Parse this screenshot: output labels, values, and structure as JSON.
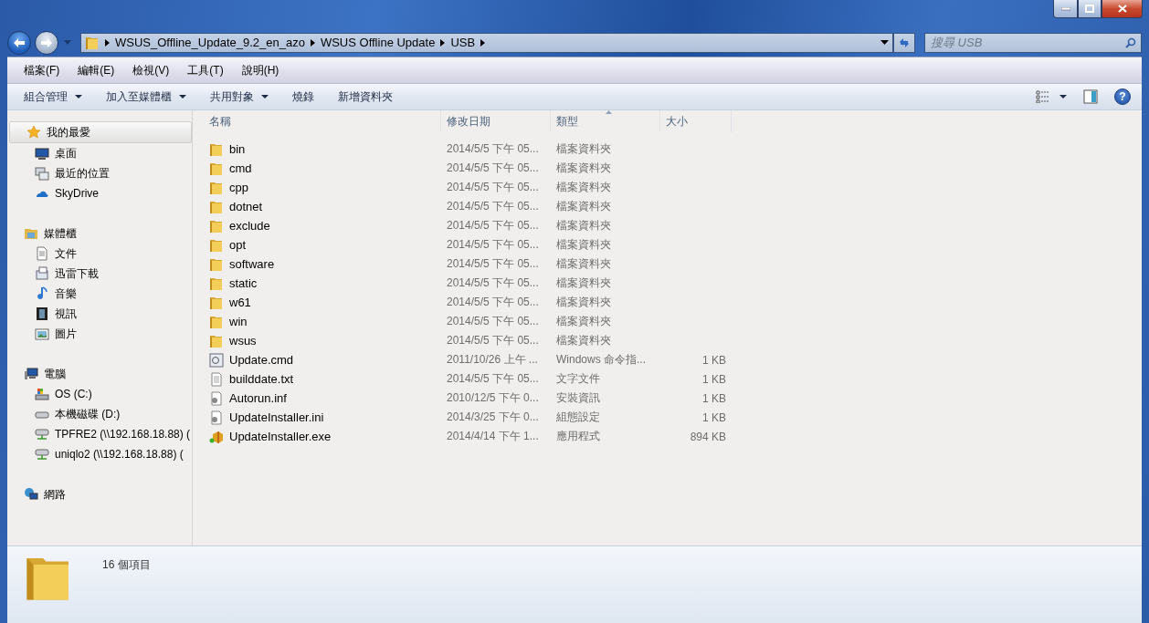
{
  "address": {
    "segments": [
      "WSUS_Offline_Update_9.2_en_azo",
      "WSUS Offline Update",
      "USB"
    ]
  },
  "search": {
    "placeholder": "搜尋 USB"
  },
  "menu": [
    "檔案(F)",
    "編輯(E)",
    "檢視(V)",
    "工具(T)",
    "說明(H)"
  ],
  "commands": [
    {
      "label": "組合管理",
      "dropdown": true
    },
    {
      "label": "加入至媒體櫃",
      "dropdown": true
    },
    {
      "label": "共用對象",
      "dropdown": true
    },
    {
      "label": "燒錄",
      "dropdown": false
    },
    {
      "label": "新增資料夾",
      "dropdown": false
    }
  ],
  "sidebar": [
    {
      "label": "我的最愛",
      "kind": "star",
      "selected": true,
      "children": [
        {
          "label": "桌面",
          "kind": "desktop",
          "selected": false
        },
        {
          "label": "最近的位置",
          "kind": "recent",
          "selected": false
        },
        {
          "label": "SkyDrive",
          "kind": "cloud",
          "selected": false
        }
      ]
    },
    {
      "label": "媒體櫃",
      "kind": "library",
      "selected": false,
      "children": [
        {
          "label": "文件",
          "kind": "document",
          "selected": false
        },
        {
          "label": "迅雷下載",
          "kind": "download",
          "selected": false
        },
        {
          "label": "音樂",
          "kind": "music",
          "selected": false
        },
        {
          "label": "視訊",
          "kind": "video",
          "selected": false
        },
        {
          "label": "圖片",
          "kind": "picture",
          "selected": false
        }
      ]
    },
    {
      "label": "電腦",
      "kind": "computer",
      "selected": false,
      "children": [
        {
          "label": "OS (C:)",
          "kind": "osdrive",
          "selected": false
        },
        {
          "label": "本機磁碟 (D:)",
          "kind": "drive",
          "selected": false
        },
        {
          "label": "TPFRE2 (\\\\192.168.18.88) (",
          "kind": "netdrive",
          "selected": false
        },
        {
          "label": "uniqlo2 (\\\\192.168.18.88) (",
          "kind": "netdrive",
          "selected": false
        }
      ]
    },
    {
      "label": "網路",
      "kind": "network",
      "selected": false
    }
  ],
  "help": "?",
  "columns": [
    {
      "label": "名稱",
      "sorted": false
    },
    {
      "label": "修改日期",
      "sorted": false
    },
    {
      "label": "類型",
      "sorted": true
    },
    {
      "label": "大小",
      "sorted": false
    }
  ],
  "files": [
    {
      "name": "bin",
      "date": "2014/5/5 下午 05...",
      "type": "檔案資料夾",
      "kind": "folder"
    },
    {
      "name": "cmd",
      "date": "2014/5/5 下午 05...",
      "type": "檔案資料夾",
      "kind": "folder"
    },
    {
      "name": "cpp",
      "date": "2014/5/5 下午 05...",
      "type": "檔案資料夾",
      "kind": "folder"
    },
    {
      "name": "dotnet",
      "date": "2014/5/5 下午 05...",
      "type": "檔案資料夾",
      "kind": "folder"
    },
    {
      "name": "exclude",
      "date": "2014/5/5 下午 05...",
      "type": "檔案資料夾",
      "kind": "folder"
    },
    {
      "name": "opt",
      "date": "2014/5/5 下午 05...",
      "type": "檔案資料夾",
      "kind": "folder"
    },
    {
      "name": "software",
      "date": "2014/5/5 下午 05...",
      "type": "檔案資料夾",
      "kind": "folder"
    },
    {
      "name": "static",
      "date": "2014/5/5 下午 05...",
      "type": "檔案資料夾",
      "kind": "folder"
    },
    {
      "name": "w61",
      "date": "2014/5/5 下午 05...",
      "type": "檔案資料夾",
      "kind": "folder"
    },
    {
      "name": "win",
      "date": "2014/5/5 下午 05...",
      "type": "檔案資料夾",
      "kind": "folder"
    },
    {
      "name": "wsus",
      "date": "2014/5/5 下午 05...",
      "type": "檔案資料夾",
      "kind": "folder"
    },
    {
      "name": "Update.cmd",
      "date": "2011/10/26 上午 ...",
      "type": "Windows 命令指...",
      "size": "1 KB",
      "kind": "script"
    },
    {
      "name": "builddate.txt",
      "date": "2014/5/5 下午 05...",
      "type": "文字文件",
      "size": "1 KB",
      "kind": "text"
    },
    {
      "name": "Autorun.inf",
      "date": "2010/12/5 下午 0...",
      "type": "安裝資訊",
      "size": "1 KB",
      "kind": "settings"
    },
    {
      "name": "UpdateInstaller.ini",
      "date": "2014/3/25 下午 0...",
      "type": "組態設定",
      "size": "1 KB",
      "kind": "settings"
    },
    {
      "name": "UpdateInstaller.exe",
      "date": "2014/4/14 下午 1...",
      "type": "應用程式",
      "size": "894 KB",
      "kind": "program"
    }
  ],
  "status": {
    "count": "16 個項目"
  }
}
